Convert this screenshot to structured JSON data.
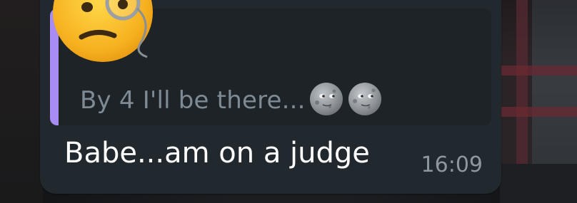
{
  "reply_preview": {
    "text": "By 4 I'll be there...",
    "emojis": [
      "new-moon-face-icon",
      "full-moon-face-icon"
    ],
    "accent_color": "#a98cf3"
  },
  "message": {
    "text": "Babe...am on a judge",
    "time": "16:09"
  },
  "overlay": {
    "emoji": "confused-face-with-monocle-icon"
  },
  "colors": {
    "bubble": "#22292e",
    "quote_background": "#1d2327",
    "message_text": "#ffffff",
    "quote_text": "#7e8b95",
    "timestamp": "#8c979e"
  }
}
